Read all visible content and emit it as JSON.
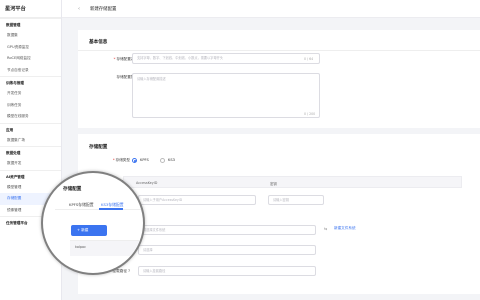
{
  "app": {
    "brand": "星河平台"
  },
  "header": {
    "collapse_icon": "‹",
    "title": "新建存储配置"
  },
  "sidebar": {
    "groups": [
      {
        "label": "数据管理",
        "items": [
          "数据集",
          "GPU资源监控",
          "RoCE网络监控",
          "节点自愈记录"
        ]
      },
      {
        "label": "训练与推理",
        "items": [
          "开发任务",
          "训练任务",
          "模型在线服务"
        ]
      },
      {
        "label": "应用",
        "items": [
          "数据集广场"
        ]
      },
      {
        "label": "数据处理",
        "items": [
          "数据开发"
        ]
      },
      {
        "label": "AI资产管理",
        "items": [
          "模型管理",
          "存储配置",
          "镜像管理"
        ]
      },
      {
        "label": "任务管理平台",
        "items": []
      }
    ],
    "active_item": "存储配置"
  },
  "basic": {
    "title": "基本信息",
    "name_label": "存储配置名称",
    "name_placeholder": "支持字母、数字、下划线、中划线、小数点，需要以字母开头",
    "name_counter": "0 / 64",
    "desc_label": "存储配置描述",
    "desc_placeholder": "请输入存储配置描述",
    "desc_counter": "0 / 200"
  },
  "storage": {
    "title": "存储配置",
    "type_label": "存储类型",
    "types": [
      "KPFS",
      "KS3"
    ],
    "selected_type": "KPFS",
    "auth_label": "访问凭证",
    "table_headers": [
      "AccessKeyID",
      "密钥"
    ],
    "ak_placeholder": "请输入子用户AccessKeyID",
    "sk_placeholder": "请输入密钥",
    "region_placeholder": "请选择文件系统",
    "refresh_icon": "⇆",
    "new_fs_link": "新建文件系统",
    "path_placeholder": "请选择",
    "mount_label": "挂载路径",
    "mount_placeholder": "请输入挂载路径",
    "help_icon": "?"
  },
  "lens": {
    "title": "存储配置",
    "tabs": [
      "KPFS存储配置",
      "KS3存储配置"
    ],
    "active_tab": "KS3存储配置",
    "add_button": "+ 新建",
    "list_item": "kolpoc"
  },
  "colors": {
    "accent": "#3b74f0",
    "required": "#e53935"
  }
}
